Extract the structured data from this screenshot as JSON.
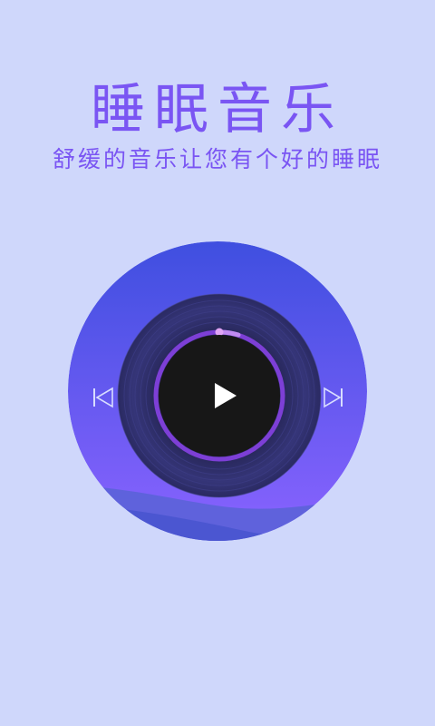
{
  "header": {
    "title": "睡眠音乐",
    "subtitle": "舒缓的音乐让您有个好的睡眠"
  },
  "player": {
    "state": "paused",
    "progress": 0.05,
    "controls": {
      "previous_icon": "skip-previous-icon",
      "play_icon": "play-icon",
      "next_icon": "skip-next-icon"
    }
  },
  "colors": {
    "background": "#cfd7fb",
    "accent": "#7a55f3",
    "disc_gradient_top": "#3f4fe0",
    "disc_gradient_bottom": "#8a63ff",
    "record": "#2a2a55",
    "center": "#171717",
    "progress_ring": "#9a52e8"
  }
}
